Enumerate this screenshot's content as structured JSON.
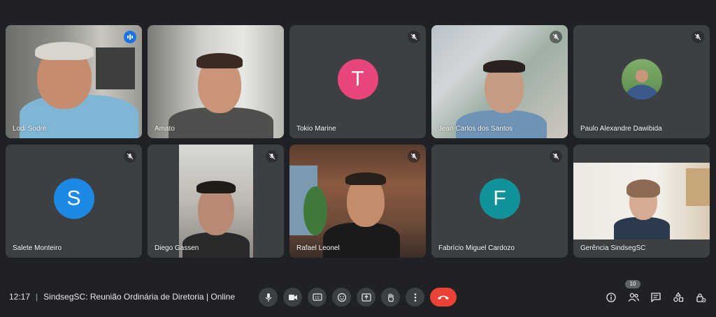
{
  "participants": [
    {
      "name": "Lodi Sodré",
      "type": "video",
      "muted": false,
      "speaking": true
    },
    {
      "name": "Amato",
      "type": "video",
      "muted": false,
      "speaking": false
    },
    {
      "name": "Tokio Marine",
      "type": "letter",
      "letter": "T",
      "color": "#e8457a",
      "muted": true
    },
    {
      "name": "Jean Carlos dos Santos",
      "type": "video",
      "muted": true
    },
    {
      "name": "Paulo Alexandre Dawibida",
      "type": "photo",
      "muted": true
    },
    {
      "name": "Salete Monteiro",
      "type": "letter",
      "letter": "S",
      "color": "#1e88e5",
      "muted": true
    },
    {
      "name": "Diego Gassen",
      "type": "video",
      "muted": true
    },
    {
      "name": "Rafael Leonel",
      "type": "video",
      "muted": true
    },
    {
      "name": "Fabrício Miguel Cardozo",
      "type": "letter",
      "letter": "F",
      "color": "#12939a",
      "muted": true
    },
    {
      "name": "Gerência SindsegSC",
      "type": "video",
      "muted": false
    }
  ],
  "meeting": {
    "time": "12:17",
    "separator": "|",
    "title": "SindsegSC: Reunião Ordinária de Diretoria | Online"
  },
  "controls": [
    "mic-icon",
    "camera-icon",
    "captions-icon",
    "emoji-icon",
    "present-icon",
    "raise-hand-icon",
    "more-options-icon",
    "end-call-icon"
  ],
  "right_controls": {
    "people_count": "10",
    "icons": [
      "info-icon",
      "people-icon",
      "chat-icon",
      "activities-icon",
      "host-controls-icon"
    ]
  },
  "colors": {
    "background": "#202124",
    "tile": "#3c4043",
    "end_call": "#ea4335",
    "active_border": "#8ab4f8"
  }
}
